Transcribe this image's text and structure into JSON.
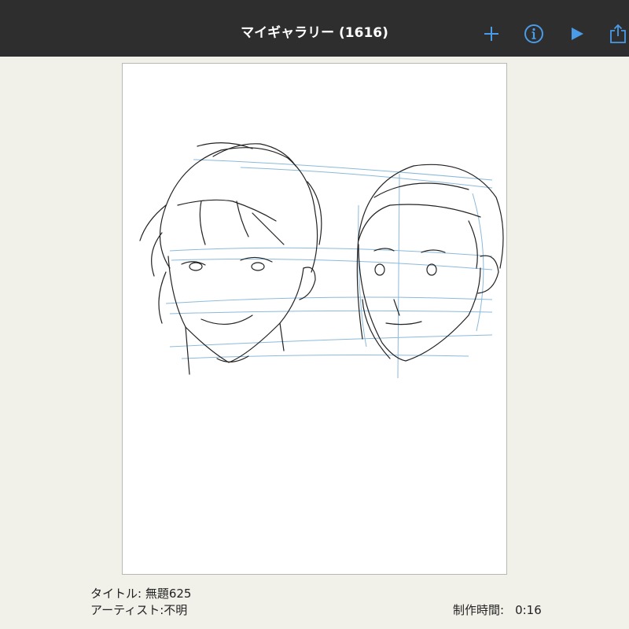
{
  "header": {
    "title": "マイギャラリー (1616)",
    "accent_color": "#4a9be8",
    "buttons": [
      {
        "name": "add-icon"
      },
      {
        "name": "info-icon"
      },
      {
        "name": "play-icon"
      },
      {
        "name": "share-icon"
      }
    ]
  },
  "artwork": {
    "description_colors": {
      "line": "#222222",
      "guide": "#7fb2d6"
    }
  },
  "details": {
    "title_label": "タイトル:",
    "title_value": "無題625",
    "artist_label": "アーティスト:",
    "artist_value": "不明",
    "time_label": "制作時間:",
    "time_value": "0:16"
  }
}
